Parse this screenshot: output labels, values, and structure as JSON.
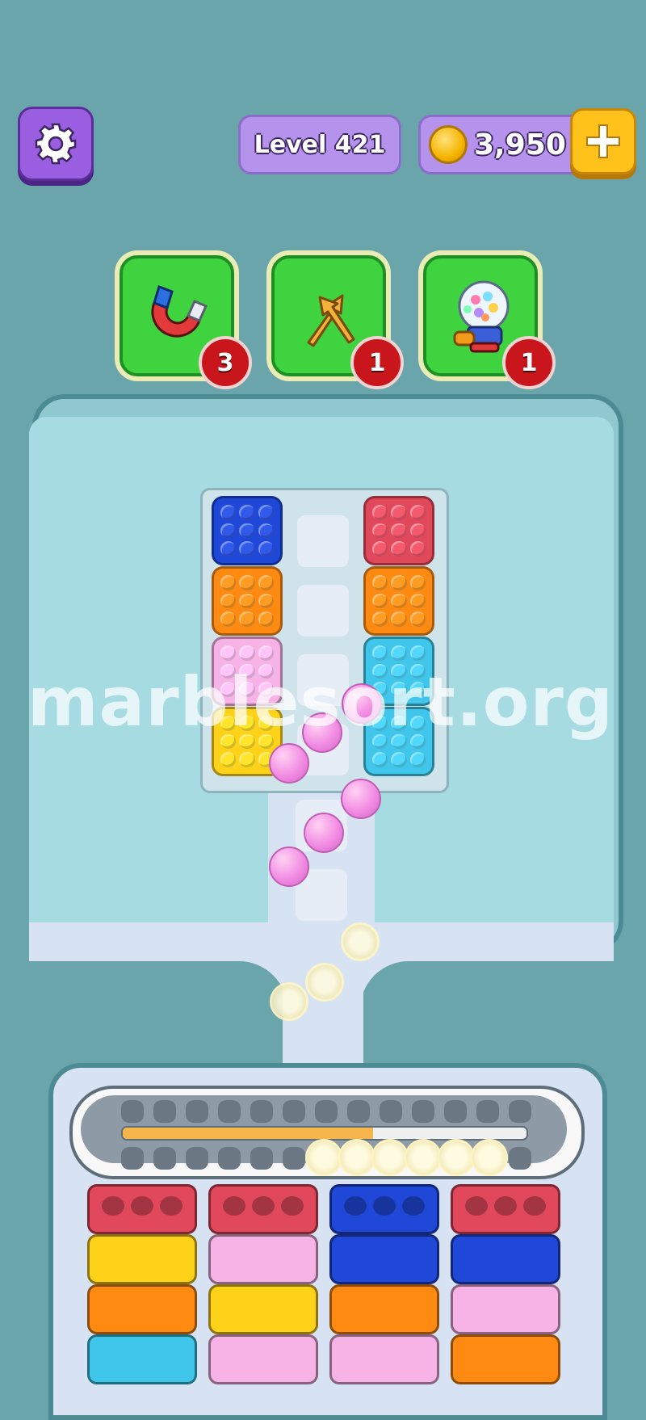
{
  "header": {
    "settings_icon": "gear-icon",
    "level_label": "Level 421",
    "coins": "3,950",
    "coin_icon": "coin-icon",
    "add_coins_icon": "plus-icon"
  },
  "boosters": [
    {
      "name": "magnet",
      "icon": "magnet-icon",
      "count": "3"
    },
    {
      "name": "shuffle",
      "icon": "crossed-arrows-icon",
      "count": "1"
    },
    {
      "name": "gumball",
      "icon": "gumball-machine-icon",
      "count": "1"
    }
  ],
  "colors": {
    "blue": "#1f48d8",
    "red": "#e2485c",
    "orange": "#ff8a12",
    "pink": "#f7b2e6",
    "cyan": "#3fc6ea",
    "yellow": "#ffd21a",
    "marble_pink": "#f28de3",
    "board": "#a6dbe2",
    "background": "#6aa5ac"
  },
  "grid": {
    "left_column": [
      "blue",
      "orange",
      "pink",
      "yellow"
    ],
    "middle_column_slots": 4,
    "right_column": [
      "red",
      "orange",
      "cyan",
      "cyan"
    ]
  },
  "conveyor": {
    "progress": 0.62,
    "loaded_marbles": 6
  },
  "tubes": [
    [
      "red",
      "yellow",
      "orange",
      "cyan"
    ],
    [
      "red",
      "pink",
      "yellow",
      "pink"
    ],
    [
      "blue",
      "blue",
      "orange",
      "pink"
    ],
    [
      "red",
      "blue",
      "pink",
      "orange"
    ]
  ],
  "watermark": "marblesort.org"
}
